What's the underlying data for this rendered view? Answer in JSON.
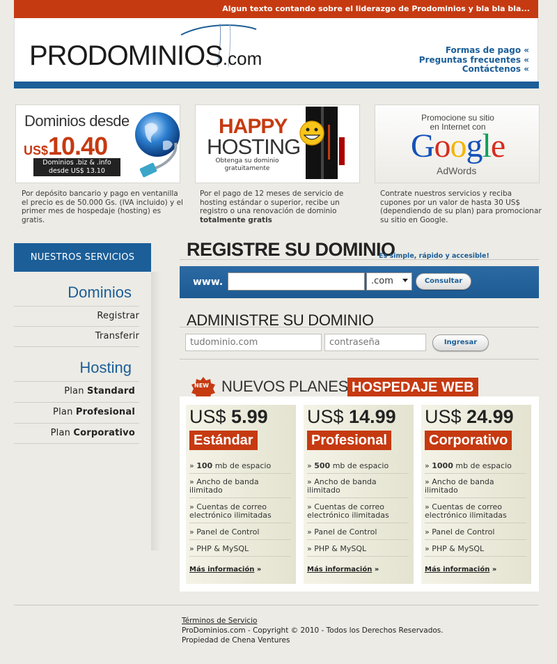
{
  "header": {
    "tagline": "Algun texto contando sobre el liderazgo de Prodominios y bla bla bla...",
    "logo_main": "PRODOMINIOS",
    "logo_suffix": ".com",
    "links": [
      "Formas de pago «",
      "Preguntas frecuentes «",
      "Contáctenos «"
    ]
  },
  "promos": [
    {
      "line1": "Dominios desde",
      "currency": "US$",
      "price": "10.40",
      "sub1": "Dominios .biz & .info",
      "sub2": "desde US$ 13.10",
      "description": "Por depósito bancario y pago en ventanilla el precio es de 50.000 Gs. (IVA incluido) y el primer mes de hospedaje (hosting) es gratis."
    },
    {
      "line1": "HAPPY",
      "line2": "HOSTING",
      "sub1": "Obtenga su dominio",
      "sub2": "gratuitamente",
      "description_prefix": "Por el pago de 12 meses de servicio de hosting estándar o superior, recibe un registro o una renovación de dominio ",
      "description_bold": "totalmente gratis"
    },
    {
      "line1": "Promocione su sitio",
      "line2": "en Internet con",
      "brand": "Google",
      "brand_sub": "AdWords",
      "description": "Contrate nuestros servicios y reciba cupones por un valor de hasta 30 US$ (dependiendo de su plan) para promocionar su sitio en Google."
    }
  ],
  "sidebar": {
    "title": "NUESTROS SERVICIOS",
    "sections": [
      {
        "heading": "Dominios",
        "items": [
          "Registrar",
          "Transferir"
        ]
      },
      {
        "heading": "Hosting",
        "items": [
          {
            "pre": "Plan ",
            "bold": "Standard"
          },
          {
            "pre": "Plan ",
            "bold": "Profesional"
          },
          {
            "pre": "Plan ",
            "bold": "Corporativo"
          }
        ]
      }
    ]
  },
  "register": {
    "title": "REGISTRE SU DOMINIO",
    "subtitle": "Es simple, rápido y accesible!",
    "prefix": "www.",
    "domain_value": "",
    "tld_selected": ".com",
    "button": "Consultar"
  },
  "admin": {
    "title": "ADMINISTRE SU DOMINIO",
    "domain_placeholder": "tudominio.com",
    "password_placeholder": "contraseña",
    "button": "Ingresar"
  },
  "plans": {
    "badge": "NEW",
    "title": "NUEVOS PLANES DE",
    "title_highlight": "HOSPEDAJE WEB",
    "cards": [
      {
        "currency": "US$",
        "price": "5.99",
        "name": "Estándar",
        "features": [
          {
            "b": "100",
            "t": " mb de espacio"
          },
          {
            "b": "",
            "t": "Ancho de banda ilimitado"
          },
          {
            "b": "",
            "t": "Cuentas de correo electrónico ilimitadas"
          },
          {
            "b": "",
            "t": "Panel de Control"
          },
          {
            "b": "",
            "t": "PHP & MySQL"
          }
        ],
        "more": "Más información"
      },
      {
        "currency": "US$",
        "price": "14.99",
        "name": "Profesional",
        "features": [
          {
            "b": "500",
            "t": " mb de espacio"
          },
          {
            "b": "",
            "t": "Ancho de banda ilimitado"
          },
          {
            "b": "",
            "t": "Cuentas de correo electrónico ilimitadas"
          },
          {
            "b": "",
            "t": "Panel de Control"
          },
          {
            "b": "",
            "t": "PHP & MySQL"
          }
        ],
        "more": "Más información"
      },
      {
        "currency": "US$",
        "price": "24.99",
        "name": "Corporativo",
        "features": [
          {
            "b": "1000",
            "t": " mb de espacio"
          },
          {
            "b": "",
            "t": "Ancho de banda ilimitado"
          },
          {
            "b": "",
            "t": "Cuentas de correo electrónico ilimitadas"
          },
          {
            "b": "",
            "t": "Panel de Control"
          },
          {
            "b": "",
            "t": "PHP & MySQL"
          }
        ],
        "more": "Más información"
      }
    ]
  },
  "footer": {
    "terms": "Términos de Servicio",
    "copyright": "ProDominios.com - Copyright © 2010 - Todos los Derechos Reservados.",
    "owner": "Propiedad de Chena Ventures"
  },
  "colors": {
    "brand_blue": "#1b5e98",
    "brand_red": "#c63a11",
    "background": "#ecebe5"
  }
}
